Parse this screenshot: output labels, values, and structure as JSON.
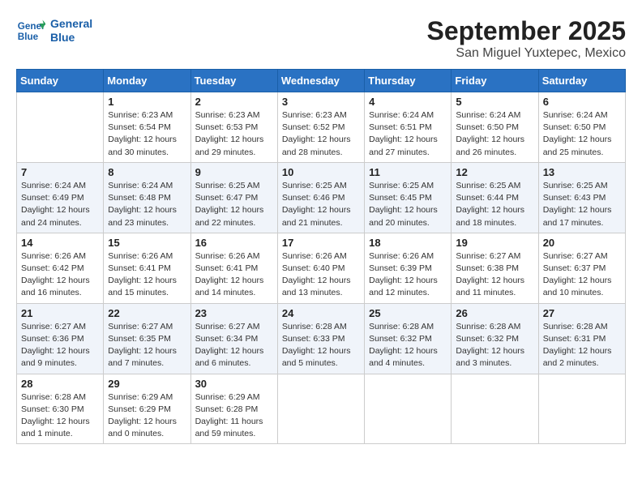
{
  "header": {
    "logo_line1": "General",
    "logo_line2": "Blue",
    "month": "September 2025",
    "location": "San Miguel Yuxtepec, Mexico"
  },
  "days_of_week": [
    "Sunday",
    "Monday",
    "Tuesday",
    "Wednesday",
    "Thursday",
    "Friday",
    "Saturday"
  ],
  "weeks": [
    [
      {
        "day": "",
        "info": ""
      },
      {
        "day": "1",
        "info": "Sunrise: 6:23 AM\nSunset: 6:54 PM\nDaylight: 12 hours\nand 30 minutes."
      },
      {
        "day": "2",
        "info": "Sunrise: 6:23 AM\nSunset: 6:53 PM\nDaylight: 12 hours\nand 29 minutes."
      },
      {
        "day": "3",
        "info": "Sunrise: 6:23 AM\nSunset: 6:52 PM\nDaylight: 12 hours\nand 28 minutes."
      },
      {
        "day": "4",
        "info": "Sunrise: 6:24 AM\nSunset: 6:51 PM\nDaylight: 12 hours\nand 27 minutes."
      },
      {
        "day": "5",
        "info": "Sunrise: 6:24 AM\nSunset: 6:50 PM\nDaylight: 12 hours\nand 26 minutes."
      },
      {
        "day": "6",
        "info": "Sunrise: 6:24 AM\nSunset: 6:50 PM\nDaylight: 12 hours\nand 25 minutes."
      }
    ],
    [
      {
        "day": "7",
        "info": "Sunrise: 6:24 AM\nSunset: 6:49 PM\nDaylight: 12 hours\nand 24 minutes."
      },
      {
        "day": "8",
        "info": "Sunrise: 6:24 AM\nSunset: 6:48 PM\nDaylight: 12 hours\nand 23 minutes."
      },
      {
        "day": "9",
        "info": "Sunrise: 6:25 AM\nSunset: 6:47 PM\nDaylight: 12 hours\nand 22 minutes."
      },
      {
        "day": "10",
        "info": "Sunrise: 6:25 AM\nSunset: 6:46 PM\nDaylight: 12 hours\nand 21 minutes."
      },
      {
        "day": "11",
        "info": "Sunrise: 6:25 AM\nSunset: 6:45 PM\nDaylight: 12 hours\nand 20 minutes."
      },
      {
        "day": "12",
        "info": "Sunrise: 6:25 AM\nSunset: 6:44 PM\nDaylight: 12 hours\nand 18 minutes."
      },
      {
        "day": "13",
        "info": "Sunrise: 6:25 AM\nSunset: 6:43 PM\nDaylight: 12 hours\nand 17 minutes."
      }
    ],
    [
      {
        "day": "14",
        "info": "Sunrise: 6:26 AM\nSunset: 6:42 PM\nDaylight: 12 hours\nand 16 minutes."
      },
      {
        "day": "15",
        "info": "Sunrise: 6:26 AM\nSunset: 6:41 PM\nDaylight: 12 hours\nand 15 minutes."
      },
      {
        "day": "16",
        "info": "Sunrise: 6:26 AM\nSunset: 6:41 PM\nDaylight: 12 hours\nand 14 minutes."
      },
      {
        "day": "17",
        "info": "Sunrise: 6:26 AM\nSunset: 6:40 PM\nDaylight: 12 hours\nand 13 minutes."
      },
      {
        "day": "18",
        "info": "Sunrise: 6:26 AM\nSunset: 6:39 PM\nDaylight: 12 hours\nand 12 minutes."
      },
      {
        "day": "19",
        "info": "Sunrise: 6:27 AM\nSunset: 6:38 PM\nDaylight: 12 hours\nand 11 minutes."
      },
      {
        "day": "20",
        "info": "Sunrise: 6:27 AM\nSunset: 6:37 PM\nDaylight: 12 hours\nand 10 minutes."
      }
    ],
    [
      {
        "day": "21",
        "info": "Sunrise: 6:27 AM\nSunset: 6:36 PM\nDaylight: 12 hours\nand 9 minutes."
      },
      {
        "day": "22",
        "info": "Sunrise: 6:27 AM\nSunset: 6:35 PM\nDaylight: 12 hours\nand 7 minutes."
      },
      {
        "day": "23",
        "info": "Sunrise: 6:27 AM\nSunset: 6:34 PM\nDaylight: 12 hours\nand 6 minutes."
      },
      {
        "day": "24",
        "info": "Sunrise: 6:28 AM\nSunset: 6:33 PM\nDaylight: 12 hours\nand 5 minutes."
      },
      {
        "day": "25",
        "info": "Sunrise: 6:28 AM\nSunset: 6:32 PM\nDaylight: 12 hours\nand 4 minutes."
      },
      {
        "day": "26",
        "info": "Sunrise: 6:28 AM\nSunset: 6:32 PM\nDaylight: 12 hours\nand 3 minutes."
      },
      {
        "day": "27",
        "info": "Sunrise: 6:28 AM\nSunset: 6:31 PM\nDaylight: 12 hours\nand 2 minutes."
      }
    ],
    [
      {
        "day": "28",
        "info": "Sunrise: 6:28 AM\nSunset: 6:30 PM\nDaylight: 12 hours\nand 1 minute."
      },
      {
        "day": "29",
        "info": "Sunrise: 6:29 AM\nSunset: 6:29 PM\nDaylight: 12 hours\nand 0 minutes."
      },
      {
        "day": "30",
        "info": "Sunrise: 6:29 AM\nSunset: 6:28 PM\nDaylight: 11 hours\nand 59 minutes."
      },
      {
        "day": "",
        "info": ""
      },
      {
        "day": "",
        "info": ""
      },
      {
        "day": "",
        "info": ""
      },
      {
        "day": "",
        "info": ""
      }
    ]
  ]
}
